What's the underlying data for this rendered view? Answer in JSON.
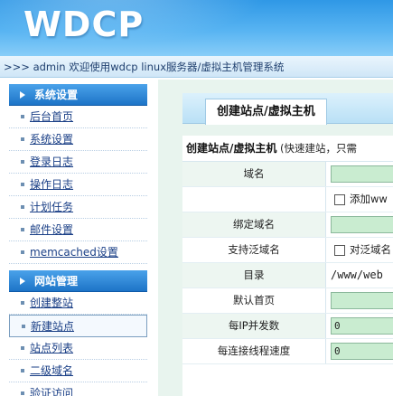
{
  "header": {
    "logo": "WDCP"
  },
  "topbar": {
    "text": ">>> admin 欢迎使用wdcp linux服务器/虚拟主机管理系统"
  },
  "sidebar": {
    "sections": [
      {
        "title": "系统设置",
        "items": [
          "后台首页",
          "系统设置",
          "登录日志",
          "操作日志",
          "计划任务",
          "邮件设置",
          "memcached设置"
        ]
      },
      {
        "title": "网站管理",
        "items": [
          "创建整站",
          "新建站点",
          "站点列表",
          "二级域名",
          "验证访问"
        ]
      }
    ]
  },
  "main": {
    "tab": "创建站点/虚拟主机",
    "form_title_bold": "创建站点/虚拟主机",
    "form_title_note": "(快速建站，只需",
    "rows": {
      "domain": {
        "label": "域名",
        "value": ""
      },
      "add_www": {
        "check_label": "添加ww"
      },
      "bind_domain": {
        "label": "绑定域名",
        "value": ""
      },
      "wildcard": {
        "label": "支持泛域名",
        "check_label": "对泛域名"
      },
      "dir": {
        "label": "目录",
        "value": "/www/web"
      },
      "index": {
        "label": "默认首页",
        "value": ""
      },
      "per_ip": {
        "label": "每IP并发数",
        "value": "0"
      },
      "speed": {
        "label": "每连接线程速度",
        "value": "0"
      }
    }
  },
  "colors": {
    "header": "#2f98e6",
    "section_head": "#1d74c7",
    "input_bg": "#c9ecd0",
    "link": "#1a3f86"
  }
}
